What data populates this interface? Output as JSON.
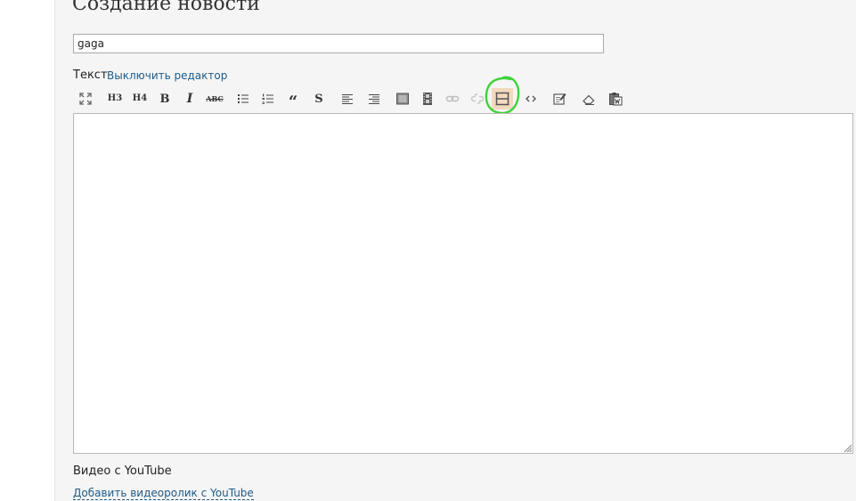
{
  "page": {
    "title": "Создание новости"
  },
  "form": {
    "title_value": "gaga",
    "text_label": "Текст",
    "toggle_editor_link": "Выключить редактор",
    "video_label": "Видео с YouTube",
    "add_video_link": "Добавить видеоролик с YouTube"
  },
  "toolbar": {
    "h3": "H3",
    "h4": "H4",
    "bold": "B",
    "italic": "I",
    "strikethrough": "ABC",
    "quote": "“",
    "spoiler": "S",
    "icons": [
      "fullscreen-icon",
      "heading-3-icon",
      "heading-4-icon",
      "bold-icon",
      "italic-icon",
      "strikethrough-icon",
      "bulleted-list-icon",
      "numbered-list-icon",
      "quote-icon",
      "spoiler-icon",
      "align-left-icon",
      "align-right-icon",
      "image-icon",
      "video-icon",
      "link-icon",
      "unlink-icon",
      "horizontal-rule-icon",
      "code-icon",
      "edit-source-icon",
      "eraser-icon",
      "paste-from-word-icon"
    ],
    "highlighted": "horizontal-rule-icon"
  },
  "colors": {
    "panel_bg": "#f5f5f5",
    "link": "#1f5a86",
    "annotation_circle": "#3fd23a",
    "hr_button_bg": "#f3d9bd"
  }
}
